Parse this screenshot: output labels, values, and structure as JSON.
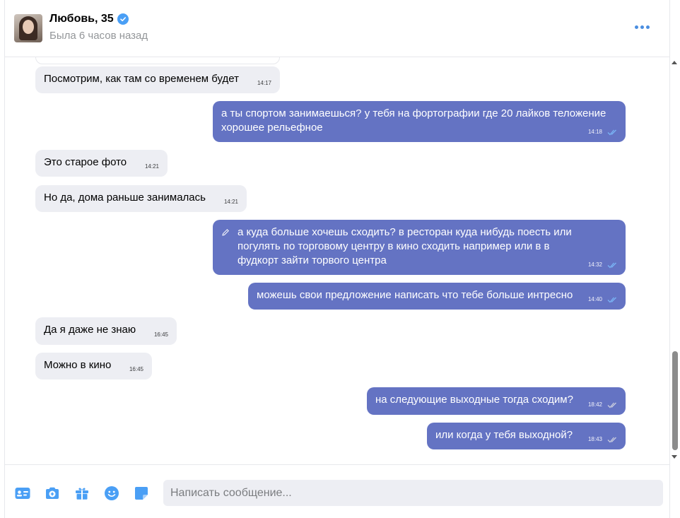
{
  "header": {
    "name": "Любовь, 35",
    "status": "Была 6 часов назад",
    "verified_color": "#4a9ff5",
    "accent": "#4a8ee0"
  },
  "messages": [
    {
      "dir": "in",
      "text": "Посмотрим, как там со временем будет",
      "time": "14:17"
    },
    {
      "dir": "out",
      "text": "а ты спортом занимаешься? у тебя на фортографии где 20 лайков теложение хорошее рельефное",
      "time": "14:18",
      "read": true
    },
    {
      "dir": "in",
      "text": "Это старое фото",
      "time": "14:21"
    },
    {
      "dir": "in",
      "text": "Но да, дома раньше занималась",
      "time": "14:21"
    },
    {
      "dir": "out",
      "text": "а куда больше хочешь сходить? в ресторан куда нибудь поесть или погулять по торговому центру в кино сходить например или в в фудкорт зайти торвого центра",
      "time": "14:32",
      "read": true,
      "edited": true
    },
    {
      "dir": "out",
      "text": "можешь свои предложение написать что тебе больше интресно",
      "time": "14:40",
      "read": true
    },
    {
      "dir": "in",
      "text": "Да я даже не знаю",
      "time": "16:45"
    },
    {
      "dir": "in",
      "text": "Можно в кино",
      "time": "16:45"
    },
    {
      "dir": "out",
      "text": "на следующие выходные тогда сходим?",
      "time": "18:42",
      "read": false
    },
    {
      "dir": "out",
      "text": "или когда у тебя выходной?",
      "time": "18:43",
      "read": false
    }
  ],
  "colors": {
    "incoming_bubble": "#edeef3",
    "outgoing_bubble": "#6473c3",
    "read_check": "#7ab4f5",
    "unread_check": "#c8ccde",
    "toolbar_icons": "#4a9ff5"
  },
  "composer": {
    "placeholder": "Написать сообщение...",
    "tools": [
      "contact-card-icon",
      "camera-plus-icon",
      "gift-icon",
      "emoji-icon",
      "sticker-icon"
    ]
  }
}
